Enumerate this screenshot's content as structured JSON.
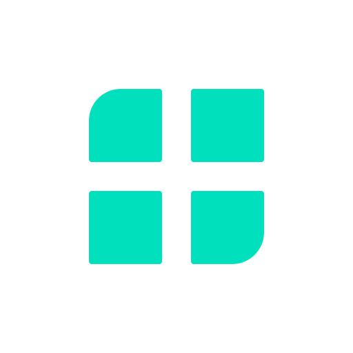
{
  "logo": {
    "icon": "four-tile-grid-icon",
    "color": "#00E0BC",
    "background": "#ffffff",
    "tiles": [
      {
        "position": "top-left",
        "shape": "rounded-top-left"
      },
      {
        "position": "top-right",
        "shape": "square"
      },
      {
        "position": "bottom-left",
        "shape": "square"
      },
      {
        "position": "bottom-right",
        "shape": "rounded-bottom-right"
      }
    ]
  }
}
